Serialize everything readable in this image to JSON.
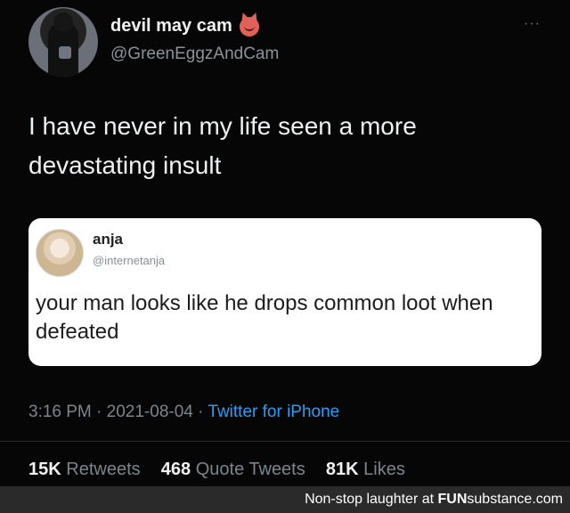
{
  "tweet": {
    "author": {
      "display_name": "devil may cam",
      "handle": "@GreenEggzAndCam",
      "badge_icon": "devil-emoji-icon"
    },
    "more_label": "···",
    "text": "I have never in my life seen a more devastating insult",
    "quoted": {
      "display_name": "anja",
      "handle": "@internetanja",
      "text": "your man looks like he drops common loot when defeated"
    },
    "time": "3:16 PM",
    "separator": "·",
    "date": "2021-08-04",
    "source": "Twitter for iPhone",
    "stats": {
      "retweets_count": "15K",
      "retweets_label": "Retweets",
      "quotes_count": "468",
      "quotes_label": "Quote Tweets",
      "likes_count": "81K",
      "likes_label": "Likes"
    }
  },
  "footer": {
    "prefix": "Non-stop laughter at ",
    "brand_a": "FUN",
    "brand_b": "substance",
    "brand_c": ".com"
  },
  "colors": {
    "background": "#050505",
    "link": "#2a9df4",
    "muted": "#7c858c",
    "footer_bg": "#2a2a2a"
  }
}
